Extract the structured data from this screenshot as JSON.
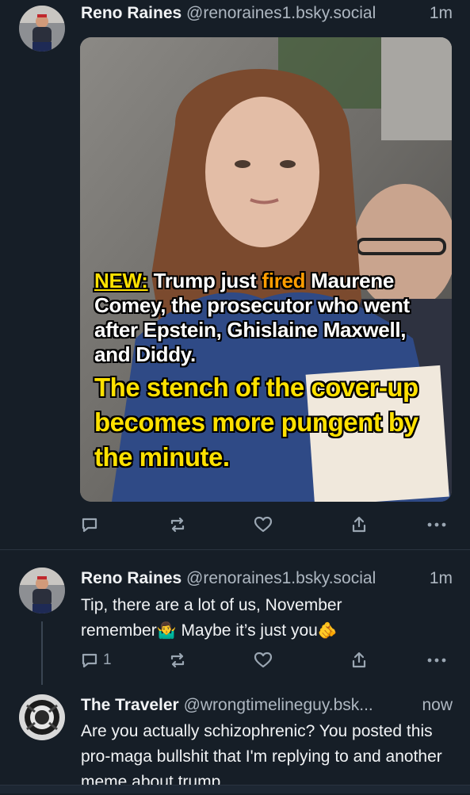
{
  "posts": [
    {
      "author": "Reno Raines",
      "handle": "@renoraines1.bsky.social",
      "time": "1m",
      "image": {
        "caption_new": "NEW:",
        "caption_part1": " Trump just ",
        "caption_fired": "fired",
        "caption_part2": " Maurene Comey, the prosecutor who went after Epstein, Ghislaine Maxwell, and Diddy.",
        "caption_yellow": "The stench of the cover-up becomes more pungent by the minute."
      },
      "reply_count": "",
      "actions": [
        "reply-icon",
        "repost-icon",
        "like-icon",
        "share-icon",
        "more-icon"
      ]
    },
    {
      "author": "Reno Raines",
      "handle": "@renoraines1.bsky.social",
      "time": "1m",
      "text_line1": "Tip, there are a lot of us, November",
      "text_line2a": "remember",
      "emoji1": "🤷‍♂️",
      "text_line2b": " Maybe it’s just you",
      "emoji2": "🫵",
      "reply_count": "1"
    },
    {
      "author": "The Traveler",
      "handle": "@wrongtimelineguy.bsk...",
      "time": "now",
      "text": "Are you actually schizophrenic? You posted this pro-maga bullshit that I'm replying to and another meme about trump"
    }
  ],
  "colors": {
    "background": "#161e27",
    "muted": "#aeb7c1",
    "icon": "#9aa6b2",
    "highlight_yellow": "#ffe100",
    "highlight_orange": "#ff9d00"
  }
}
